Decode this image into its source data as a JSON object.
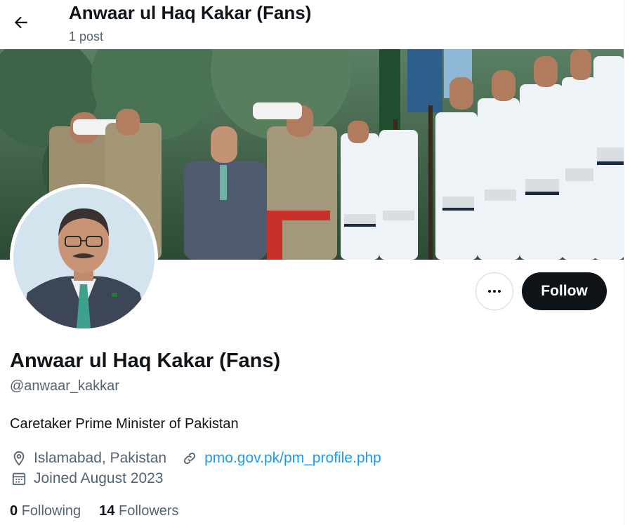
{
  "header": {
    "title": "Anwaar ul Haq Kakar (Fans)",
    "post_count": "1 post",
    "back_icon": "arrow-left-icon"
  },
  "actions": {
    "more_icon": "more-dots-icon",
    "follow_label": "Follow"
  },
  "profile": {
    "name": "Anwaar ul Haq Kakar (Fans)",
    "handle": "@anwaar_kakkar",
    "bio": "Caretaker Prime Minister of Pakistan",
    "location": "Islamabad, Pakistan",
    "location_icon": "location-pin-icon",
    "website": "pmo.gov.pk/pm_profile.php",
    "website_icon": "link-icon",
    "joined": "Joined August 2023",
    "joined_icon": "calendar-icon"
  },
  "stats": {
    "following_count": "0",
    "following_label": "Following",
    "followers_count": "14",
    "followers_label": "Followers"
  },
  "colors": {
    "text_primary": "#0f1419",
    "text_secondary": "#536471",
    "link": "#1d9bf0",
    "button_dark": "#0f1419"
  }
}
